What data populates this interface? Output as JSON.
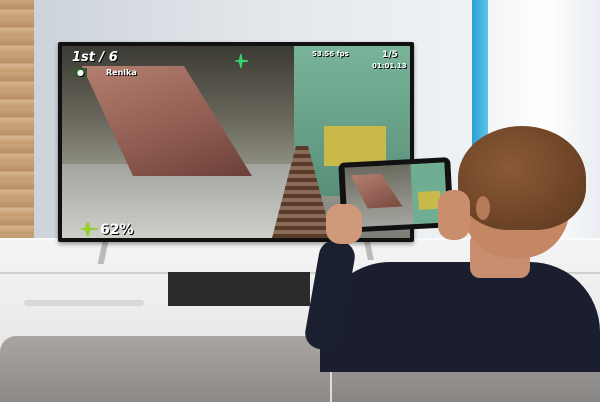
{
  "scene": {
    "tv_hud": {
      "position": "1st / 6",
      "player_name": "Renika",
      "fps": "53.56 fps",
      "lap": "1/5",
      "lap_time": "01:01.13",
      "speed_percent": "62%"
    }
  },
  "colors": {
    "accent_blue": "#2aa0d4",
    "hud_green": "#2f5a2f",
    "tv_frame": "#111111",
    "sweater": "#1a1e2e"
  },
  "icons": [
    "plane-icon",
    "leaf-icon"
  ]
}
